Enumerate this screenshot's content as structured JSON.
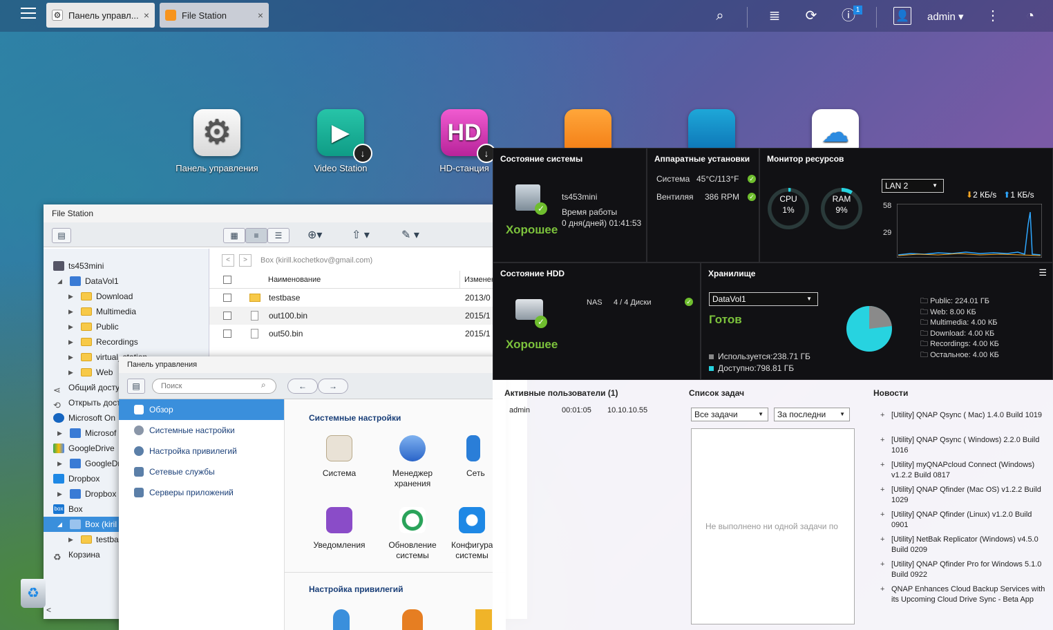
{
  "topbar": {
    "tabs": [
      {
        "label": "Панель управл...",
        "close": "×"
      },
      {
        "label": "File Station",
        "close": "×"
      }
    ],
    "notification_count": "1",
    "user": "admin ▾"
  },
  "desktop": {
    "icons": [
      {
        "label": "Панель управления"
      },
      {
        "label": "Video Station"
      },
      {
        "label": "HD-станция"
      }
    ]
  },
  "file_station": {
    "title": "File Station",
    "path": "Box (kirill.kochetkov@gmail.com)",
    "columns": {
      "name": "Наименование",
      "modified": "Изменен"
    },
    "tree": [
      "ts453mini",
      "DataVol1",
      "Download",
      "Multimedia",
      "Public",
      "Recordings",
      "virtual_station",
      "Web",
      "Общий досту",
      "Открыть доступ",
      "Microsoft On",
      "Microsof",
      "GoogleDrive",
      "GoogleDr",
      "Dropbox",
      "Dropbox",
      "Box",
      "Box (kiril",
      "testba",
      "Корзина"
    ],
    "files": [
      {
        "name": "testbase",
        "date": "2013/0"
      },
      {
        "name": "out100.bin",
        "date": "2015/1"
      },
      {
        "name": "out50.bin",
        "date": "2015/1"
      }
    ],
    "scroll_left": "<"
  },
  "control_panel": {
    "title": "Панель управления",
    "search_placeholder": "Поиск",
    "menu": [
      "Обзор",
      "Системные настройки",
      "Настройка привилегий",
      "Сетевые службы",
      "Серверы приложений"
    ],
    "sections": {
      "system": "Системные настройки",
      "privileges": "Настройка привилегий"
    },
    "items": [
      "Система",
      "Менеджер хранения",
      "Сеть",
      "Уведомления",
      "Обновление системы",
      "Конфигурация системы"
    ]
  },
  "dashboard": {
    "system": {
      "title": "Состояние системы",
      "host": "ts453mini",
      "uptime_label": "Время работы",
      "uptime": "0 дня(дней) 01:41:53",
      "status": "Хорошее"
    },
    "hardware": {
      "title": "Аппаратные установки",
      "rows": [
        {
          "label": "Система",
          "value": "45°C/113°F"
        },
        {
          "label": "Вентиляя",
          "value": "386 RPM"
        }
      ]
    },
    "monitor": {
      "title": "Монитор ресурсов",
      "cpu_label": "CPU",
      "cpu": "1%",
      "cpu_value": 1,
      "ram_label": "RAM",
      "ram": "9%",
      "ram_value": 9,
      "lan": "LAN 2",
      "down": "2 КБ/s",
      "up": "1 КБ/s",
      "y_top": "58",
      "y_mid": "29"
    },
    "hdd": {
      "title": "Состояние HDD",
      "nas": "NAS",
      "disks": "4 / 4 Диски",
      "status": "Хорошее"
    },
    "storage": {
      "title": "Хранилище",
      "volume": "DataVol1",
      "status": "Готов",
      "used": "Используется:238.71 ГБ",
      "free": "Доступно:798.81 ГБ",
      "legend": [
        "Public: 224.01 ГБ",
        "Web: 8.00 КБ",
        "Multimedia: 4.00 КБ",
        "Download: 4.00 КБ",
        "Recordings: 4.00 КБ",
        "Остальное: 4.00 КБ"
      ],
      "used_fraction": 0.23
    }
  },
  "lower": {
    "users_title": "Активные пользователи (1)",
    "user": {
      "name": "admin",
      "time": "00:01:05",
      "ip": "10.10.10.55"
    },
    "tasks_title": "Список задач",
    "tasks_filter": "Все задачи",
    "tasks_period": "За последни",
    "tasks_empty": "Не выполнено ни одной задачи по",
    "news_title": "Новости",
    "news": [
      "[Utility] QNAP Qsync ( Mac) 1.4.0 Build 1019",
      "[Utility] QNAP Qsync ( Windows) 2.2.0 Build 1016",
      "[Utility] myQNAPcloud Connect (Windows) v1.2.2 Build 0817",
      "[Utility] QNAP Qfinder (Mac OS) v1.2.2 Build 1029",
      "[Utility] QNAP Qfinder (Linux) v1.2.0 Build 0901",
      "[Utility] NetBak Replicator (Windows) v4.5.0 Build 0209",
      "[Utility] QNAP Qfinder Pro for Windows 5.1.0 Build 0922",
      "QNAP Enhances Cloud Backup Services with its Upcoming Cloud Drive Sync - Beta App"
    ]
  }
}
